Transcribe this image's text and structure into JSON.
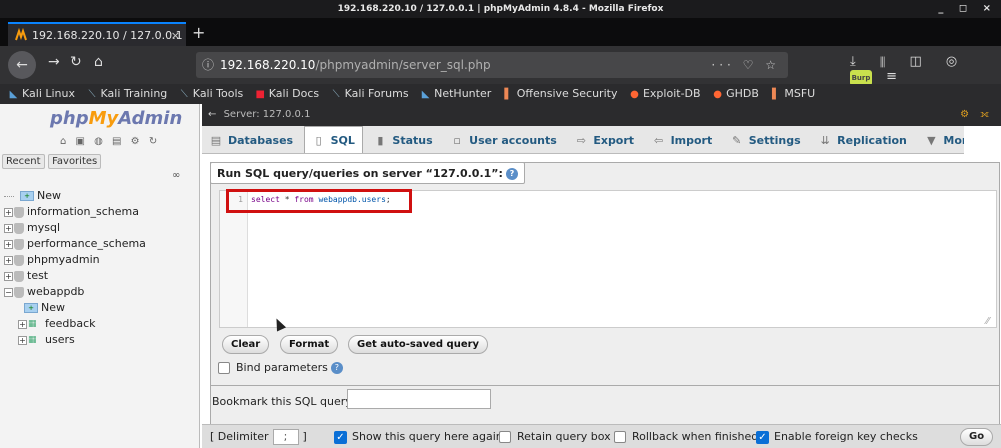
{
  "window": {
    "title": "192.168.220.10 / 127.0.0.1 | phpMyAdmin 4.8.4 - Mozilla Firefox",
    "controls": "_ ◻ ×"
  },
  "browser": {
    "tab_title": "192.168.220.10 / 127.0.0.1",
    "tab_close": "×",
    "new_tab": "+",
    "url_host": "192.168.220.10",
    "url_path": "/phpmyadmin/server_sql.php",
    "url_actions": "··· ♡ ☆",
    "toolbar_icons": "⤓ ⫴ ◫ ◎",
    "burp_label": "Burp",
    "menu_icon": "≡",
    "back": "←",
    "forward": "→",
    "reload": "↻",
    "home": "⌂",
    "info_icon": "ⓘ",
    "bookmarks": [
      {
        "icon": "◣",
        "label": "Kali Linux"
      },
      {
        "icon": "⟍",
        "label": "Kali Training"
      },
      {
        "icon": "⟍",
        "label": "Kali Tools"
      },
      {
        "icon": "■",
        "label": "Kali Docs"
      },
      {
        "icon": "⟍",
        "label": "Kali Forums"
      },
      {
        "icon": "◣",
        "label": "NetHunter"
      },
      {
        "icon": "▌",
        "label": "Offensive Security"
      },
      {
        "icon": "●",
        "label": "Exploit-DB"
      },
      {
        "icon": "●",
        "label": "GHDB"
      },
      {
        "icon": "▌",
        "label": "MSFU"
      }
    ]
  },
  "sidebar": {
    "logo_php": "php",
    "logo_my": "My",
    "logo_admin": "Admin",
    "nav_icons": "⌂ ▣ ◍ ▤ ⚙ ↻",
    "tab_recent": "Recent",
    "tab_favorites": "Favorites",
    "link_icon": "∞",
    "tree": {
      "new_root": "New",
      "databases": [
        "information_schema",
        "mysql",
        "performance_schema",
        "phpmyadmin",
        "test"
      ],
      "expanded_db": "webappdb",
      "new_child": "New",
      "tables": [
        "feedback",
        "users"
      ]
    }
  },
  "main": {
    "server_label": "Server: 127.0.0.1",
    "server_actions": "⚙ ⟗",
    "tabs": [
      {
        "icon": "▤",
        "label": "Databases"
      },
      {
        "icon": "▯",
        "label": "SQL"
      },
      {
        "icon": "▮",
        "label": "Status"
      },
      {
        "icon": "▫",
        "label": "User accounts"
      },
      {
        "icon": "⇨",
        "label": "Export"
      },
      {
        "icon": "⇦",
        "label": "Import"
      },
      {
        "icon": "✎",
        "label": "Settings"
      },
      {
        "icon": "⇊",
        "label": "Replication"
      },
      {
        "icon": "▼",
        "label": "More"
      }
    ],
    "query_legend": "Run SQL query/queries on server “127.0.0.1”:",
    "help_icon": "?",
    "editor": {
      "line_number": "1",
      "kw_select": "select",
      "rest_1": " * ",
      "kw_from": "from",
      "rest_2": " ",
      "table_ref": "webappdb.users",
      "rest_3": ";"
    },
    "resize_glyph": "⁄⁄",
    "buttons": {
      "clear": "Clear",
      "format": "Format",
      "autosaved": "Get auto-saved query"
    },
    "bind_parameters": "Bind parameters",
    "bookmark_label": "Bookmark this SQL query:",
    "bookmark_value": "",
    "bottom": {
      "delimiter_open": "[ Delimiter",
      "delimiter_value": ";",
      "delimiter_close": "]",
      "show_query": "Show this query here again",
      "retain_box": "Retain query box",
      "rollback": "Rollback when finished",
      "foreign_keys": "Enable foreign key checks",
      "check_glyph": "✓",
      "go": "Go"
    }
  },
  "colors": {
    "pma_blue": "#6c78af",
    "pma_orange": "#f89c0e",
    "highlight_red": "#d01010",
    "checkbox_blue": "#0a6fd6"
  }
}
